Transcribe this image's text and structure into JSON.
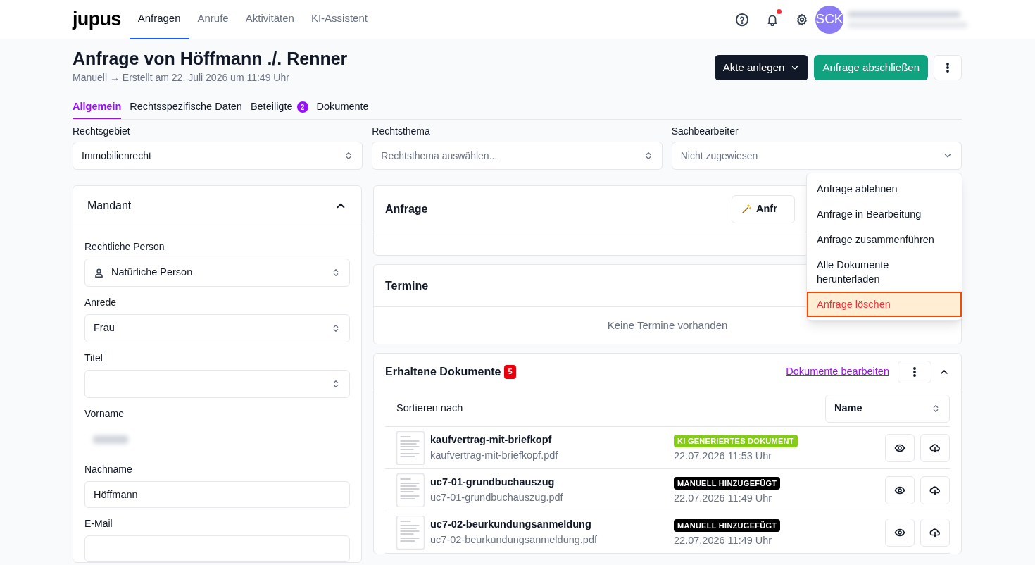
{
  "nav": {
    "logo": "jupus",
    "items": [
      {
        "label": "Anfragen",
        "selected": true
      },
      {
        "label": "Anrufe",
        "selected": false
      },
      {
        "label": "Aktivitäten",
        "selected": false
      },
      {
        "label": "KI-Assistent",
        "selected": false
      }
    ],
    "notifications_unread": true,
    "avatar": "SCK"
  },
  "header": {
    "title": "Anfrage von Höffmann ./. Renner",
    "subtitle": "Manuell → Erstellt am 22. Juli 2026 um 11:49 Uhr",
    "actions": [
      {
        "kind": "dark",
        "label": "Akte anlegen"
      },
      {
        "kind": "primary",
        "label": "Anfrage abschließen"
      },
      {
        "kind": "more"
      }
    ]
  },
  "tabs": [
    {
      "label": "Allgemein",
      "selected": true
    },
    {
      "label": "Rechtsspezifische Daten",
      "selected": false
    },
    {
      "label": "Beteiligte",
      "selected": false,
      "badge": "2"
    },
    {
      "label": "Dokumente",
      "selected": false
    }
  ],
  "filters": [
    {
      "label": "Rechtsgebiet",
      "value": "Immobilienrecht",
      "kind": "updown"
    },
    {
      "label": "Rechtsthema",
      "placeholder": "Rechtsthema auswählen...",
      "kind": "updown"
    },
    {
      "label": "Sachbearbeiter",
      "placeholder": "Nicht zugewiesen",
      "kind": "chevron"
    }
  ],
  "mandant": {
    "title": "Mandant",
    "expanded": true,
    "fields": [
      {
        "label": "Rechtliche Person",
        "kind": "person_select",
        "value": "Natürliche Person"
      },
      {
        "label": "Anrede",
        "kind": "select",
        "value": "Frau"
      },
      {
        "label": "Titel",
        "kind": "select"
      },
      {
        "label": "Vorname",
        "kind": "redacted"
      },
      {
        "label": "Nachname",
        "kind": "input",
        "value": "Höffmann"
      },
      {
        "label": "E-Mail",
        "kind": "input"
      }
    ]
  },
  "anfrage": {
    "title": "Anfrage",
    "button": "Anfr"
  },
  "termine": {
    "title": "Termine",
    "empty": "Keine Termine vorhanden"
  },
  "documents": {
    "title": "Erhaltene Dokumente",
    "count": "5",
    "link": "Dokumente bearbeiten",
    "expanded": true,
    "sort_label": "Sortieren nach",
    "sort_value": "Name",
    "items": [
      {
        "name": "kaufvertrag-mit-briefkopf",
        "file": "kaufvertrag-mit-briefkopf.pdf",
        "tag": "KI GENERIERTES DOKUMENT",
        "color": "#84cc16",
        "date": "22.07.2026 11:53 Uhr"
      },
      {
        "name": "uc7-01-grundbuchauszug",
        "file": "uc7-01-grundbuchauszug.pdf",
        "tag": "MANUELL HINZUGEFÜGT",
        "color": "#000000",
        "date": "22.07.2026 11:49 Uhr"
      },
      {
        "name": "uc7-02-beurkundungsanmeldung",
        "file": "uc7-02-beurkundungsanmeldung.pdf",
        "tag": "MANUELL HINZUGEFÜGT",
        "color": "#000000",
        "date": "22.07.2026 11:49 Uhr"
      }
    ]
  },
  "menu": {
    "items": [
      {
        "label": "Anfrage ablehnen",
        "kind": "normal",
        "highlighted": false
      },
      {
        "label": "Anfrage in Bearbeitung",
        "kind": "normal",
        "highlighted": false
      },
      {
        "label": "Anfrage zusammenführen",
        "kind": "normal",
        "highlighted": false
      },
      {
        "label": "Alle Dokumente herunterladen",
        "kind": "normal",
        "highlighted": false
      },
      {
        "label": "Anfrage löschen",
        "kind": "danger",
        "highlighted": true
      }
    ]
  }
}
